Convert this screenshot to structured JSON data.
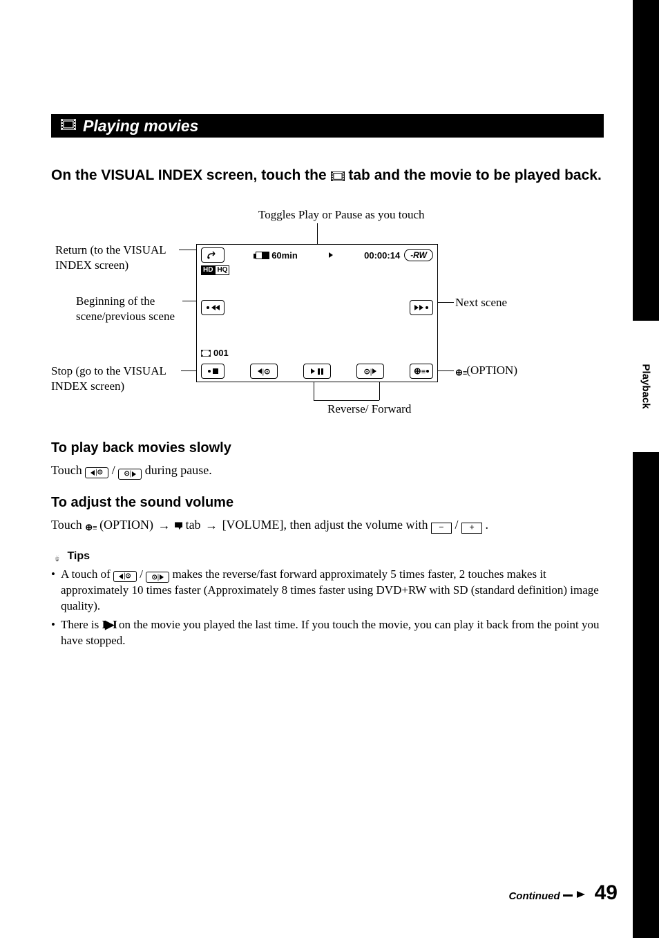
{
  "sideTab": "Playback",
  "section": {
    "title": "Playing movies"
  },
  "intro": {
    "pre": "On the VISUAL INDEX screen, touch the ",
    "post": " tab and the movie to be played back."
  },
  "diagram": {
    "topCaption": "Toggles Play or Pause as you touch",
    "labels": {
      "return": "Return (to the VISUAL INDEX screen)",
      "prev": "Beginning of the scene/previous scene",
      "stop": "Stop (go to the VISUAL INDEX screen)",
      "next": "Next scene",
      "option": "(OPTION)",
      "revfwd": "Reverse/ Forward"
    },
    "screen": {
      "battery": "60min",
      "timecode": "00:00:14",
      "disc": "-RW",
      "sceneNum": "001",
      "quality": {
        "hd": "HD",
        "hq": "HQ"
      }
    }
  },
  "sub1": {
    "head": "To play back movies slowly",
    "text_pre": "Touch ",
    "text_post": " during pause."
  },
  "sub2": {
    "head": "To adjust the sound volume",
    "t1": "Touch ",
    "t2": "(OPTION) ",
    "t3": " tab ",
    "t4": " [VOLUME], then adjust the volume with ",
    "t5": "."
  },
  "tips": {
    "head": "Tips",
    "items": [
      {
        "pre": "A touch of ",
        "post": " makes the reverse/fast forward approximately 5 times faster, 2 touches makes it approximately 10 times faster (Approximately 8 times faster using DVD+RW with SD (standard definition) image quality)."
      },
      {
        "pre": "There is ",
        "post": " on the movie you played the last time. If you touch the movie, you can play it back from the point you have stopped."
      }
    ]
  },
  "footer": {
    "continued": "Continued",
    "page": "49"
  }
}
